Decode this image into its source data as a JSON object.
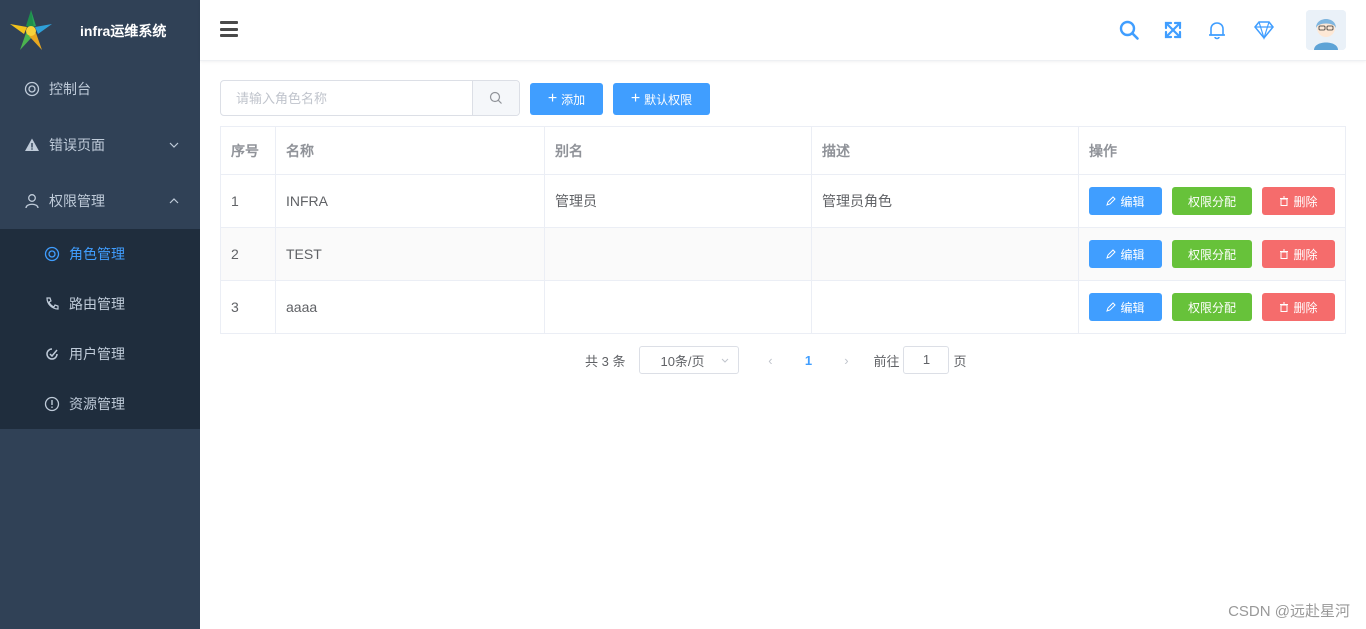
{
  "app": {
    "title": "infra运维系统"
  },
  "sidebar": {
    "items": [
      {
        "label": "控制台",
        "icon": "dashboard-icon"
      },
      {
        "label": "错误页面",
        "icon": "warning-icon",
        "expanded": false
      },
      {
        "label": "权限管理",
        "icon": "user-icon",
        "expanded": true
      }
    ],
    "subitems": [
      {
        "label": "角色管理",
        "icon": "role-icon",
        "active": true
      },
      {
        "label": "路由管理",
        "icon": "route-icon",
        "active": false
      },
      {
        "label": "用户管理",
        "icon": "user-manage-icon",
        "active": false
      },
      {
        "label": "资源管理",
        "icon": "resource-icon",
        "active": false
      }
    ]
  },
  "header": {
    "icons": [
      "search-icon",
      "fullscreen-icon",
      "bell-icon",
      "diamond-icon"
    ]
  },
  "toolbar": {
    "search_placeholder": "请输入角色名称",
    "add_label": "添加",
    "default_perm_label": "默认权限"
  },
  "table": {
    "headers": [
      "序号",
      "名称",
      "别名",
      "描述",
      "操作"
    ],
    "rows": [
      {
        "index": "1",
        "name": "INFRA",
        "alias": "管理员",
        "desc": "管理员角色"
      },
      {
        "index": "2",
        "name": "TEST",
        "alias": "",
        "desc": ""
      },
      {
        "index": "3",
        "name": "aaaa",
        "alias": "",
        "desc": ""
      }
    ],
    "edit_label": "编辑",
    "assign_label": "权限分配",
    "delete_label": "删除"
  },
  "pagination": {
    "total_text": "共 3 条",
    "page_size": "10条/页",
    "current_page": "1",
    "goto_label": "前往",
    "goto_value": "1",
    "page_suffix": "页"
  },
  "watermark": "CSDN @远赴星河",
  "colors": {
    "sidebar_bg": "#304156",
    "primary": "#409eff",
    "success": "#67c23a",
    "danger": "#f56c6c"
  }
}
